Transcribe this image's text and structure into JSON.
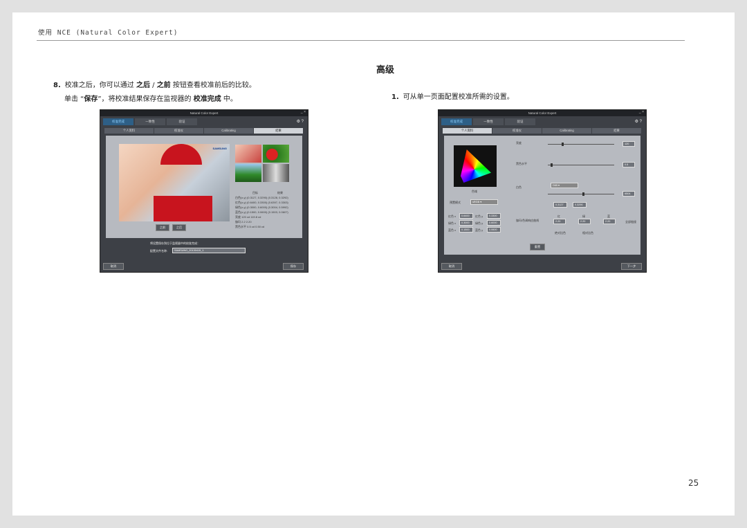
{
  "header": {
    "title": "使用 NCE (Natural Color Expert)"
  },
  "left": {
    "step_number": "8.",
    "line1_pre": "校准之后，你可以通过 ",
    "line1_b1": "之后",
    "line1_sep": " / ",
    "line1_b2": "之前",
    "line1_post": " 按钮查看校准前后的比较。",
    "line2_pre": "单击 “",
    "line2_b1": "保存",
    "line2_mid": "”，将校准结果保存在监视器的 ",
    "line2_b2": "校准完成",
    "line2_post": " 中。"
  },
  "right": {
    "section_title": "高级",
    "step_number": "1.",
    "step_text": "可从单一页面配置校准所需的设置。"
  },
  "page_number": "25",
  "shot1": {
    "title": "Natural Color Expert",
    "tabs": [
      "校准完成",
      "一致性",
      "验证"
    ],
    "steps": [
      "个人资料",
      "校准仪",
      "Calibrating",
      "结果"
    ],
    "image_logo": "SAMSUNG",
    "compare_buttons": [
      "之前",
      "之后"
    ],
    "stats_header": [
      "目标",
      "结果"
    ],
    "stats_rows": [
      [
        "白色(x,y)",
        "(0.3127, 0.3290)",
        "(0.3128, 0.3292)"
      ],
      [
        "红色(x,y)",
        "(0.6400, 0.3300)",
        "(0.6397, 0.3303)"
      ],
      [
        "绿色(x,y)",
        "(0.3000, 0.6000)",
        "(0.3004, 0.5992)"
      ],
      [
        "蓝色(x,y)",
        "(0.1500, 0.0600)",
        "(0.1503, 0.0607)"
      ],
      [
        "亮度",
        "120 cd",
        "119.8 cd"
      ],
      [
        "伽玛",
        "2.2",
        "2.20"
      ],
      [
        "黑色水平",
        "0.5 cd",
        "0.50 cd"
      ]
    ],
    "note": "将设置保存到位于监视器中的校准完成：",
    "filename_label": "配置文件名称:",
    "filename_value": "SAMSUNG_20130415_1",
    "buttons": {
      "cancel": "取消",
      "save": "保存"
    }
  },
  "shot2": {
    "title": "Natural Color Expert",
    "tabs": [
      "校准完成",
      "一致性",
      "验证"
    ],
    "steps": [
      "个人资料",
      "校准仪",
      "Calibrating",
      "结果"
    ],
    "gamut_label": "色域",
    "preset_label": "预置模式",
    "preset_value": "sRGB",
    "primaries": [
      [
        "红色 x",
        "0.6400",
        "红色 y",
        "0.3300"
      ],
      [
        "绿色 x",
        "0.3000",
        "绿色 y",
        "0.6000"
      ],
      [
        "蓝色 x",
        "0.1500",
        "蓝色 y",
        "0.0600"
      ]
    ],
    "settings": [
      {
        "label": "亮度",
        "value": "120"
      },
      {
        "label": "黑色水平",
        "value": "0.5"
      },
      {
        "label": "白色",
        "value": "6504"
      }
    ],
    "white_preset": "D65",
    "white_xy": [
      "0.3127",
      "0.3290"
    ],
    "gamma_label": "伽玛/色调响应曲线",
    "gamma_values": [
      "2.20",
      "2.20",
      "2.20"
    ],
    "gamma_channels": [
      "红",
      "绿",
      "蓝"
    ],
    "gamma_options": [
      "绝对比色",
      "相对比色"
    ],
    "gamma_link": "全部链接",
    "reset_button": "重置",
    "buttons": {
      "cancel": "取消",
      "next": "下一步"
    }
  }
}
